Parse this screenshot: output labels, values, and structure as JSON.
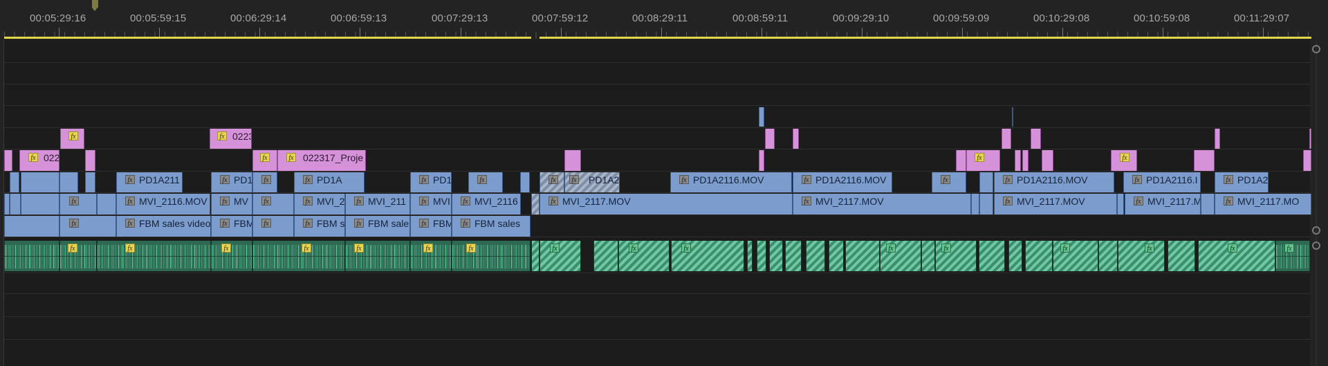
{
  "ruler": {
    "timecodes": [
      "00:05:29:16",
      "00:05:59:15",
      "00:06:29:14",
      "00:06:59:13",
      "00:07:29:13",
      "00:07:59:12",
      "00:08:29:11",
      "00:08:59:11",
      "00:09:29:10",
      "00:09:59:09",
      "00:10:29:08",
      "00:10:59:08",
      "00:11:29:07"
    ]
  },
  "clips": {
    "v3_a": "022",
    "v3_b": "0223",
    "v2_a": "022317_Proje",
    "v1_a": "PD1A211",
    "v1_b": "PD1",
    "v1_c": "PD1A",
    "v1_d": "PD1",
    "v1_e": "PD1A2",
    "v1_f": "PD1A2116.MOV",
    "v1_g": "PD1A2116.MOV",
    "v1_h": "PD1A2116.MOV",
    "v1_i": "PD1A2116.I",
    "v1_j": "PD1A2",
    "v0_a": "MVI_2116.MOV",
    "v0_b": "MV",
    "v0_c": "MVI_2",
    "v0_d": "MVI_211",
    "v0_e": "MVI",
    "v0_f": "MVI_2116",
    "v0_g": "MVI_2117.MOV",
    "v0_h": "MVI_2117.MOV",
    "v0_i": "MVI_2117.MOV",
    "v0_j": "MVI_2117.M",
    "v0_k": "MVI_2117.MO",
    "vb_a": "FBM sales video",
    "vb_b": "FBM",
    "vb_c": "FBM s",
    "vb_d": "FBM sale",
    "vb_e": "FBM",
    "vb_f": "FBM sales"
  },
  "fx_label": "fx",
  "colors": {
    "video": "#7b9ccc",
    "adjustment": "#d692d9",
    "audio": "#2e6a53",
    "work_area": "#e2d84a",
    "fx_badge": "#e7d553"
  }
}
